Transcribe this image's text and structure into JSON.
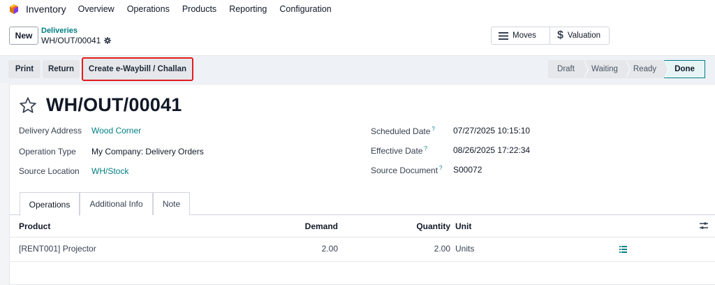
{
  "navbar": {
    "app_name": "Inventory",
    "menu": [
      "Overview",
      "Operations",
      "Products",
      "Reporting",
      "Configuration"
    ]
  },
  "control": {
    "new_label": "New",
    "breadcrumb_parent": "Deliveries",
    "breadcrumb_current": "WH/OUT/00041",
    "smart_buttons": {
      "moves": "Moves",
      "valuation": "Valuation"
    }
  },
  "actions": {
    "print": "Print",
    "return": "Return",
    "ewaybill": "Create e-Waybill / Challan"
  },
  "status": {
    "steps": [
      "Draft",
      "Waiting",
      "Ready",
      "Done"
    ],
    "current": "Done"
  },
  "record": {
    "title": "WH/OUT/00041",
    "left_fields": [
      {
        "label": "Delivery Address",
        "value": "Wood Corner"
      },
      {
        "label": "Operation Type",
        "value": "My Company: Delivery Orders"
      },
      {
        "label": "Source Location",
        "value": "WH/Stock"
      }
    ],
    "right_fields": [
      {
        "label": "Scheduled Date",
        "value": "07/27/2025 10:15:10"
      },
      {
        "label": "Effective Date",
        "value": "08/26/2025 17:22:34"
      },
      {
        "label": "Source Document",
        "value": "S00072"
      }
    ],
    "help_mark": "?"
  },
  "tabs": [
    "Operations",
    "Additional Info",
    "Note"
  ],
  "table": {
    "headers": {
      "product": "Product",
      "demand": "Demand",
      "quantity": "Quantity",
      "unit": "Unit"
    },
    "rows": [
      {
        "product": "[RENT001] Projector",
        "demand": "2.00",
        "quantity": "2.00",
        "unit": "Units"
      }
    ]
  },
  "colors": {
    "accent": "#017e84",
    "highlight_border": "#e11d1d"
  }
}
